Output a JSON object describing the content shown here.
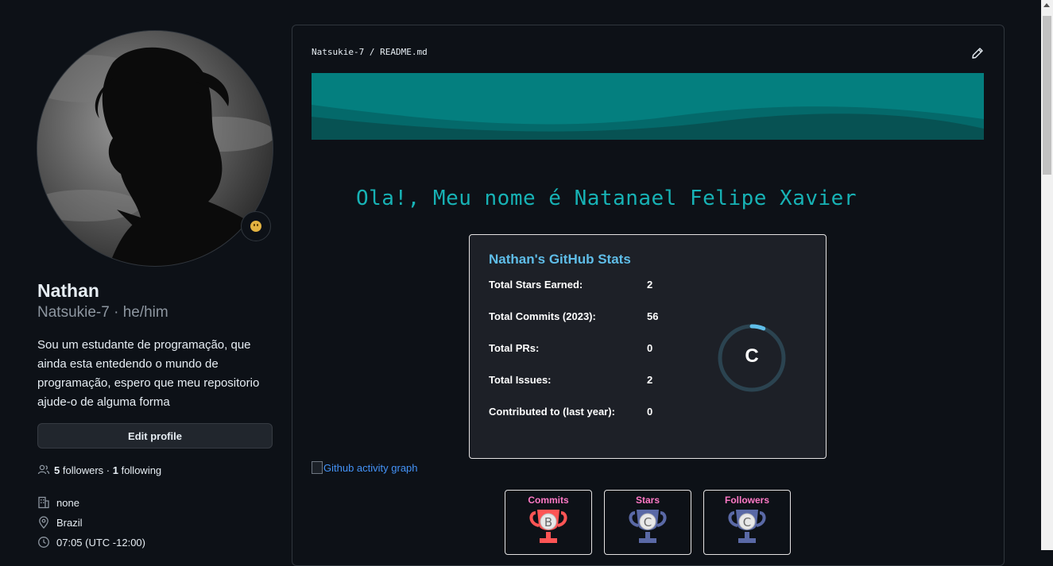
{
  "profile": {
    "name": "Nathan",
    "login_line": "Natsukie-7 · he/him",
    "bio": "Sou um estudante de programação, que ainda esta entedendo o mundo de programação, espero que meu repositorio ajude-o de alguma forma",
    "edit_label": "Edit profile",
    "followers_count": "5",
    "followers_label": "followers",
    "separator": " · ",
    "following_count": "1",
    "following_label": "following",
    "company": "none",
    "location": "Brazil",
    "local_time": "07:05 (UTC -12:00)"
  },
  "readme": {
    "breadcrumb_owner": "Natsukie-7",
    "breadcrumb_sep": " / ",
    "breadcrumb_file": "README.md",
    "headline": "Ola!, Meu nome é Natanael Felipe Xavier",
    "activity_alt": "Github activity graph"
  },
  "stats": {
    "title": "Nathan's GitHub Stats",
    "rows": [
      {
        "label": "Total Stars Earned:",
        "value": "2"
      },
      {
        "label": "Total Commits (2023):",
        "value": "56"
      },
      {
        "label": "Total PRs:",
        "value": "0"
      },
      {
        "label": "Total Issues:",
        "value": "2"
      },
      {
        "label": "Contributed to (last year):",
        "value": "0"
      }
    ],
    "rank": "C",
    "rank_progress": 0.06
  },
  "trophies": [
    {
      "label": "Commits",
      "grade": "B",
      "color": "#ff5555"
    },
    {
      "label": "Stars",
      "grade": "C",
      "color": "#5a69a6"
    },
    {
      "label": "Followers",
      "grade": "C",
      "color": "#5a69a6"
    }
  ],
  "colors": {
    "accent_teal": "#17b2b5",
    "stats_title": "#5fbde8",
    "trophy_label": "#ff79c6",
    "link": "#4493f8"
  }
}
